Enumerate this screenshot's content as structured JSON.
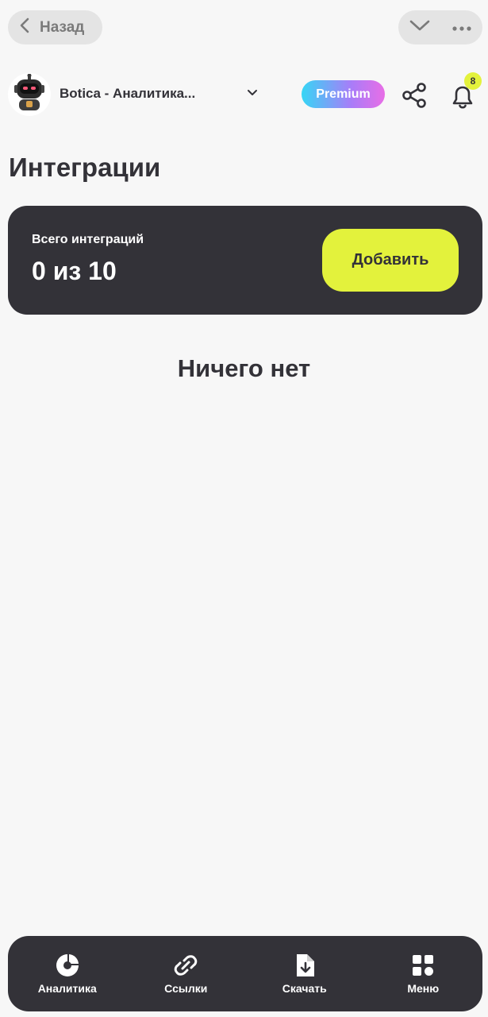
{
  "topbar": {
    "back_label": "Назад"
  },
  "header": {
    "project_name": "Botica - Аналитика...",
    "premium_label": "Premium",
    "notifications_count": "8"
  },
  "page": {
    "title": "Интеграции"
  },
  "summary": {
    "label": "Всего интеграций",
    "value": "0 из 10",
    "add_label": "Добавить"
  },
  "empty_state": {
    "text": "Ничего нет"
  },
  "bottom_nav": {
    "items": [
      {
        "label": "Аналитика",
        "icon": "pie-chart-icon"
      },
      {
        "label": "Ссылки",
        "icon": "link-icon"
      },
      {
        "label": "Скачать",
        "icon": "download-file-icon"
      },
      {
        "label": "Меню",
        "icon": "grid-menu-icon"
      }
    ]
  },
  "colors": {
    "background": "#f7f7f7",
    "dark": "#333238",
    "accent": "#e3f23c",
    "pill": "#e4e4e4"
  }
}
